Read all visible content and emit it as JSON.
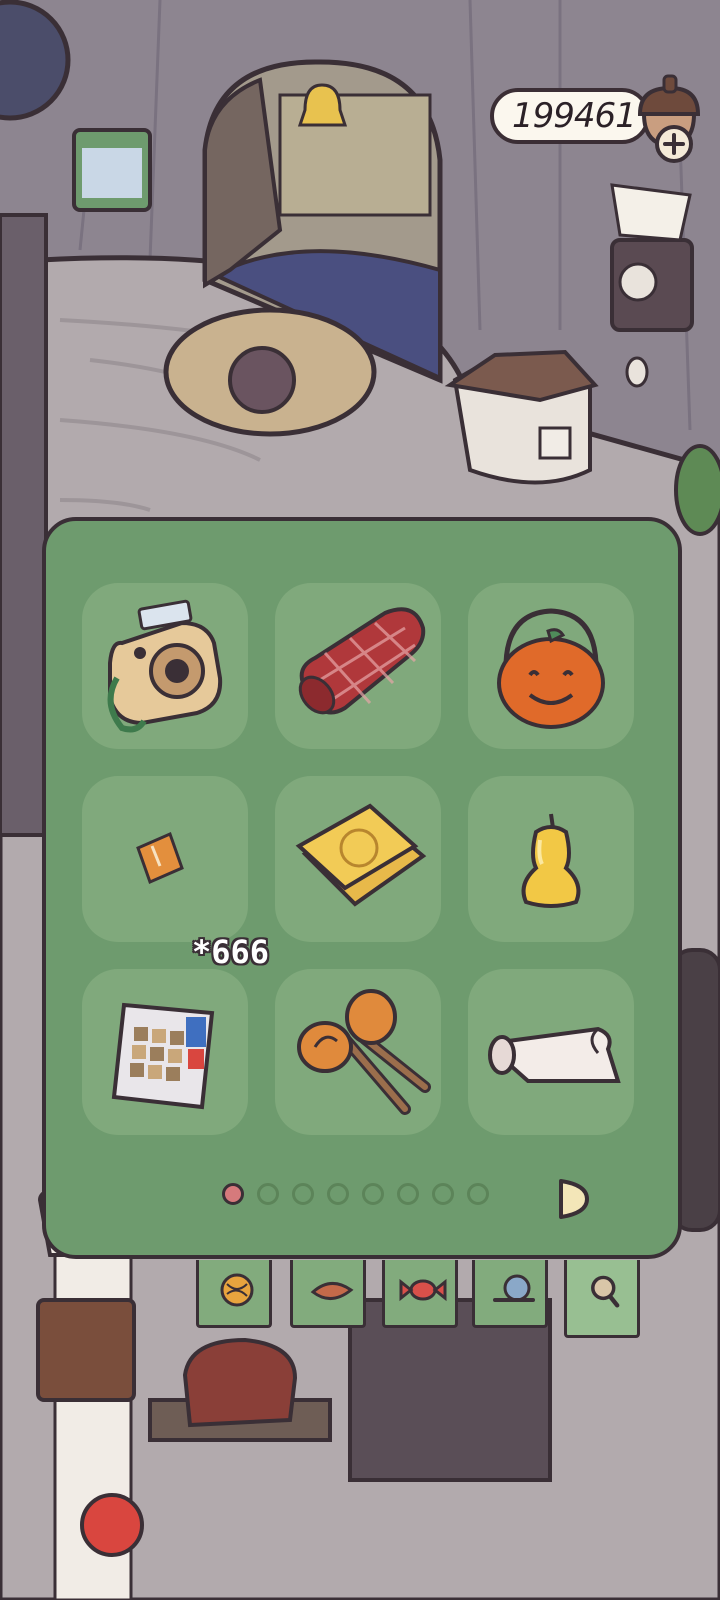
{
  "hud": {
    "currency_amount": "199461",
    "currency_icon": "acorn-icon",
    "add_icon": "plus-icon"
  },
  "inventory": {
    "items": [
      {
        "name": "instant-camera",
        "icon": "camera-icon"
      },
      {
        "name": "picnic-blanket",
        "icon": "rolled-blanket-icon"
      },
      {
        "name": "pumpkin-bucket",
        "icon": "pumpkin-basket-icon"
      },
      {
        "name": "ticket",
        "icon": "ticket-icon",
        "quantity": "*666"
      },
      {
        "name": "yellow-card",
        "icon": "card-icon"
      },
      {
        "name": "candle",
        "icon": "candle-icon"
      },
      {
        "name": "puzzle-tablet",
        "icon": "tablet-icon"
      },
      {
        "name": "maracas",
        "icon": "maracas-icon"
      },
      {
        "name": "paper-roll",
        "icon": "paper-roll-icon"
      }
    ],
    "page_count": 8,
    "current_page": 1
  },
  "tabs": [
    {
      "icon": "yarn-ball-icon"
    },
    {
      "icon": "leaf-icon"
    },
    {
      "icon": "candy-icon"
    },
    {
      "icon": "snail-icon"
    },
    {
      "icon": "magnifier-icon",
      "active": true
    }
  ],
  "colors": {
    "panel": "#6e9b6e",
    "slot": "#80a97c",
    "outline": "#3a2f36",
    "active_dot": "#d67a7c"
  }
}
